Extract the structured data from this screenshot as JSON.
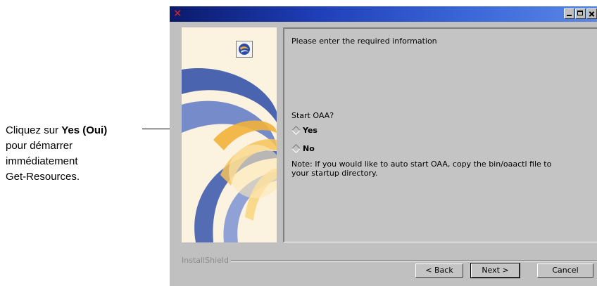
{
  "callout": {
    "prefix": "Cliquez sur ",
    "bold": "Yes (Oui)",
    "line2": "pour démarrer",
    "line3": "immédiatement",
    "line4": "Get-Resources."
  },
  "window": {
    "title_icon": "x-icon",
    "controls": [
      "minimize",
      "maximize",
      "close"
    ]
  },
  "content": {
    "prompt": "Please enter the required information",
    "question": "Start OAA?",
    "options": [
      {
        "label": "Yes",
        "selected": true
      },
      {
        "label": "No",
        "selected": false
      }
    ],
    "note_line1": "Note:  If you would like to auto start OAA, copy the bin/oaactl file to",
    "note_line2": "your startup directory."
  },
  "brand": "InstallShield",
  "buttons": {
    "back": "< Back",
    "next": "Next >",
    "cancel": "Cancel"
  },
  "colors": {
    "title_start": "#0a1a6b",
    "title_end": "#5b86e6",
    "panel_bg": "#c4c4c4",
    "graphic_blue": "#2b4aa8",
    "graphic_orange": "#f2b13a"
  }
}
